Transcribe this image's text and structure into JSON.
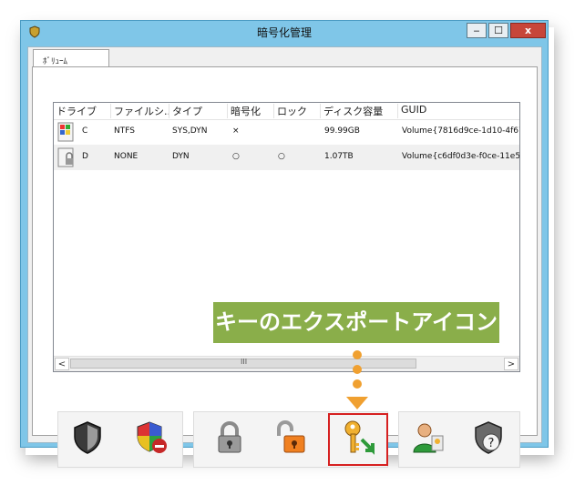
{
  "window": {
    "title": "暗号化管理",
    "buttons": {
      "minimize": "‒",
      "maximize": "☐",
      "close": "x"
    }
  },
  "tab": {
    "label": "ﾎﾞﾘｭｰﾑ"
  },
  "columns": [
    "ドライブ",
    "ファイルシ...",
    "タイプ",
    "暗号化",
    "ロック",
    "ディスク容量",
    "GUID"
  ],
  "rows": [
    {
      "drive": "C",
      "fs": "NTFS",
      "type": "SYS,DYN",
      "encrypted": "×",
      "locked": "",
      "capacity": "99.99GB",
      "guid": "Volume{7816d9ce-1d10-4f67-"
    },
    {
      "drive": "D",
      "fs": "NONE",
      "type": "DYN",
      "encrypted": "○",
      "locked": "○",
      "capacity": "1.07TB",
      "guid": "Volume{c6df0d3e-f0ce-11e5-"
    }
  ],
  "scrollbar": {
    "left": "<",
    "right": ">",
    "grip": "III"
  },
  "callout": {
    "text": "キーのエクスポートアイコン"
  },
  "toolbar": [
    "shield-icon",
    "shield-remove-icon",
    "lock-icon",
    "unlock-icon",
    "key-export-icon",
    "user-key-icon",
    "shield-help-icon"
  ],
  "colors": {
    "callout": "#8aae4a",
    "accent": "#f0a030",
    "highlight": "#d62020",
    "titlebar": "#7fc6e8"
  }
}
